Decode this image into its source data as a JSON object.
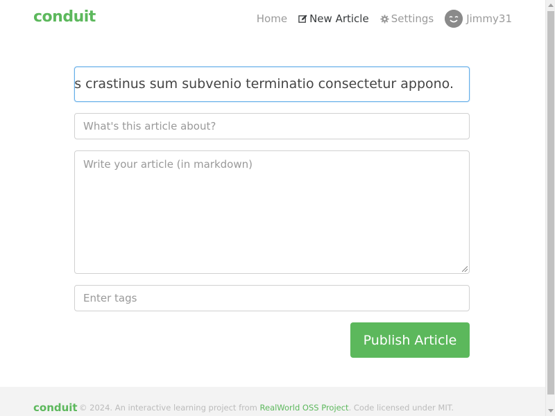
{
  "brand": {
    "name": "conduit",
    "color": "#5cb85c"
  },
  "nav": {
    "items": [
      {
        "label": "Home",
        "icon": null,
        "active": false
      },
      {
        "label": "New Article",
        "icon": "edit-icon",
        "active": true
      },
      {
        "label": "Settings",
        "icon": "gear-icon",
        "active": false
      }
    ],
    "user": {
      "name": "Jimmy31",
      "avatar": "avatar-smiley-icon"
    }
  },
  "editor": {
    "title_value": "Tenuis crastinus sum subvenio terminatio consectetur appono.",
    "about_placeholder": "What's this article about?",
    "body_placeholder": "Write your article (in markdown)",
    "tags_placeholder": "Enter tags",
    "publish_label": "Publish Article"
  },
  "footer": {
    "brand": "conduit",
    "text_prefix": "© 2024. An interactive learning project from ",
    "link_text": "RealWorld OSS Project",
    "text_suffix": ". Code licensed under MIT."
  },
  "colors": {
    "accent": "#5cb85c",
    "focus_border": "#66afe9",
    "muted_text": "#9a9a9a",
    "footer_bg": "#f3f3f3"
  }
}
